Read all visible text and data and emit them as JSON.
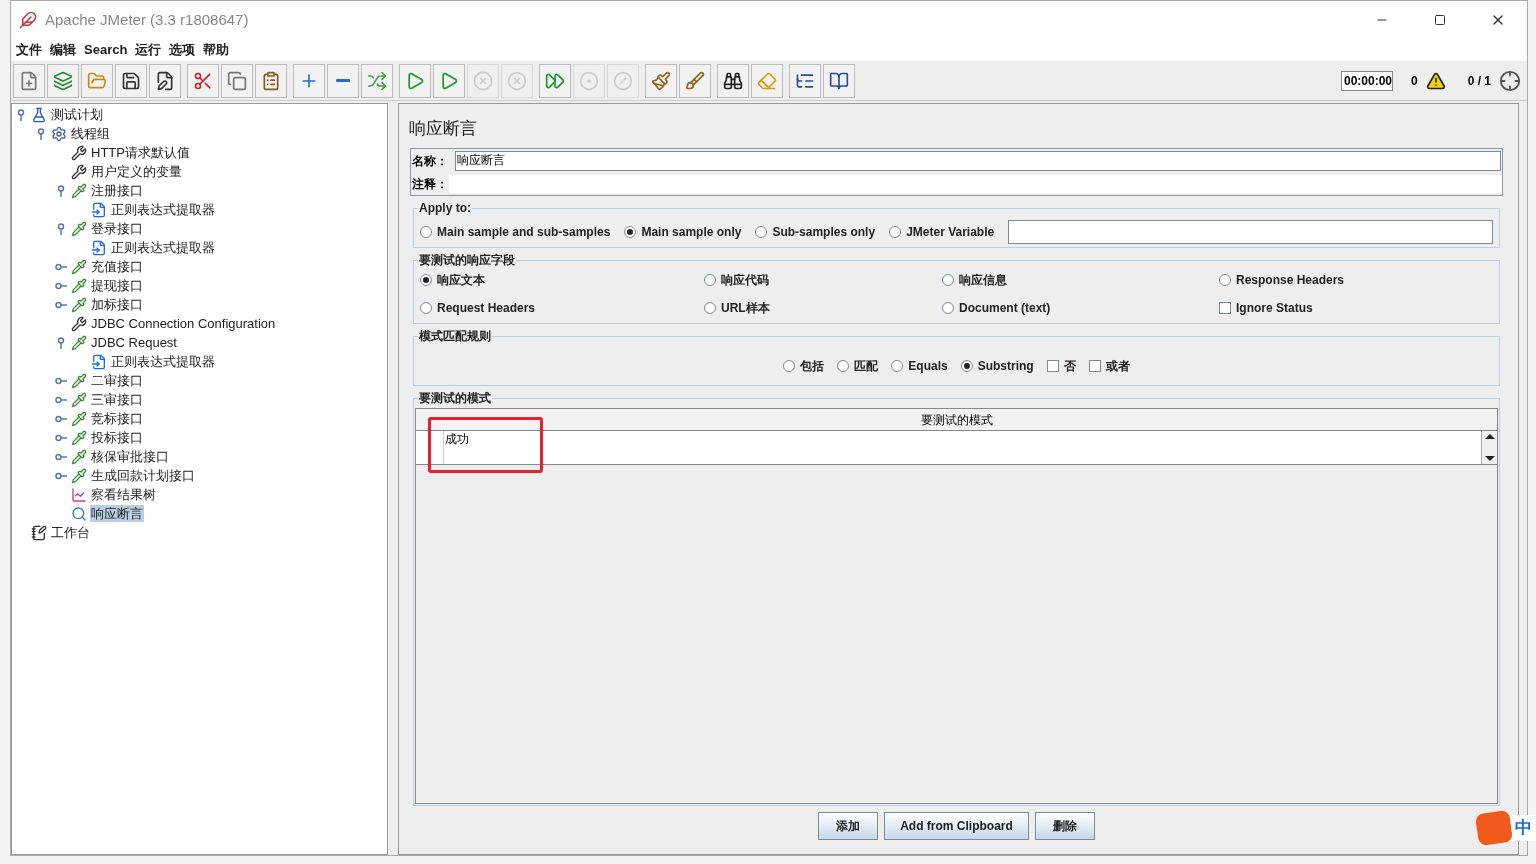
{
  "window": {
    "title": "Apache JMeter (3.3 r1808647)"
  },
  "menu": [
    "文件",
    "编辑",
    "Search",
    "运行",
    "选项",
    "帮助"
  ],
  "toolbar": [
    [
      {
        "kind": "new",
        "disabled": false
      },
      {
        "kind": "templates",
        "disabled": false
      },
      {
        "kind": "open",
        "disabled": false
      },
      {
        "kind": "save",
        "disabled": false
      },
      {
        "kind": "saveas",
        "disabled": false
      }
    ],
    [
      {
        "kind": "cut",
        "disabled": false
      },
      {
        "kind": "copy",
        "disabled": false
      },
      {
        "kind": "paste",
        "disabled": false
      }
    ],
    [
      {
        "kind": "expand",
        "disabled": false
      },
      {
        "kind": "collapse",
        "disabled": false
      },
      {
        "kind": "toggle",
        "disabled": false
      }
    ],
    [
      {
        "kind": "start",
        "disabled": false
      },
      {
        "kind": "startnopause",
        "disabled": false
      },
      {
        "kind": "stop",
        "disabled": true
      },
      {
        "kind": "shutdown",
        "disabled": true
      }
    ],
    [
      {
        "kind": "remotestart",
        "disabled": false
      },
      {
        "kind": "remotestop",
        "disabled": true
      },
      {
        "kind": "remoteexit",
        "disabled": true
      }
    ],
    [
      {
        "kind": "clear",
        "disabled": false
      },
      {
        "kind": "clearall",
        "disabled": false
      }
    ],
    [
      {
        "kind": "search",
        "disabled": false
      },
      {
        "kind": "reset",
        "disabled": false
      }
    ],
    [
      {
        "kind": "functions",
        "disabled": false
      },
      {
        "kind": "help",
        "disabled": false
      }
    ]
  ],
  "status": {
    "timer": "00:00:00",
    "warnings": "0",
    "threads": "0 / 1"
  },
  "tree": [
    {
      "label": "测试计划",
      "kind": "plan",
      "expanded": true,
      "selected": false,
      "children": [
        {
          "label": "线程组",
          "kind": "threadgroup",
          "expanded": true,
          "selected": false,
          "children": [
            {
              "label": "HTTP请求默认值",
              "kind": "config",
              "selected": false
            },
            {
              "label": "用户定义的变量",
              "kind": "config",
              "selected": false
            },
            {
              "label": "注册接口",
              "kind": "sampler",
              "expanded": true,
              "selected": false,
              "children": [
                {
                  "label": "正则表达式提取器",
                  "kind": "extractor",
                  "selected": false
                }
              ]
            },
            {
              "label": "登录接口",
              "kind": "sampler",
              "expanded": true,
              "selected": false,
              "children": [
                {
                  "label": "正则表达式提取器",
                  "kind": "extractor",
                  "selected": false
                }
              ]
            },
            {
              "label": "充值接口",
              "kind": "sampler",
              "expanded": false,
              "selected": false
            },
            {
              "label": "提现接口",
              "kind": "sampler",
              "expanded": false,
              "selected": false
            },
            {
              "label": "加标接口",
              "kind": "sampler",
              "expanded": false,
              "selected": false
            },
            {
              "label": "JDBC Connection Configuration",
              "kind": "config",
              "selected": false
            },
            {
              "label": "JDBC Request",
              "kind": "sampler",
              "expanded": true,
              "selected": false,
              "children": [
                {
                  "label": "正则表达式提取器",
                  "kind": "extractor",
                  "selected": false
                }
              ]
            },
            {
              "label": "二审接口",
              "kind": "sampler",
              "expanded": false,
              "selected": false
            },
            {
              "label": "三审接口",
              "kind": "sampler",
              "expanded": false,
              "selected": false
            },
            {
              "label": "竞标接口",
              "kind": "sampler",
              "expanded": false,
              "selected": false
            },
            {
              "label": "投标接口",
              "kind": "sampler",
              "expanded": false,
              "selected": false
            },
            {
              "label": "核保审批接口",
              "kind": "sampler",
              "expanded": false,
              "selected": false
            },
            {
              "label": "生成回款计划接口",
              "kind": "sampler",
              "expanded": false,
              "selected": false
            },
            {
              "label": "察看结果树",
              "kind": "listener",
              "selected": false
            },
            {
              "label": "响应断言",
              "kind": "assertion",
              "selected": true
            }
          ]
        }
      ]
    },
    {
      "label": "工作台",
      "kind": "workbench",
      "selected": false
    }
  ],
  "panel": {
    "title": "响应断言",
    "name_label": "名称：",
    "name_value": "响应断言",
    "comment_label": "注释：",
    "apply_to": {
      "legend": "Apply to:",
      "options": [
        {
          "label": "Main sample and sub-samples",
          "selected": false
        },
        {
          "label": "Main sample only",
          "selected": true
        },
        {
          "label": "Sub-samples only",
          "selected": false
        },
        {
          "label": "JMeter Variable",
          "selected": false
        }
      ]
    },
    "field": {
      "legend": "要测试的响应字段",
      "options": [
        {
          "label": "响应文本",
          "kind": "radio",
          "selected": true
        },
        {
          "label": "响应代码",
          "kind": "radio",
          "selected": false
        },
        {
          "label": "响应信息",
          "kind": "radio",
          "selected": false
        },
        {
          "label": "Response Headers",
          "kind": "radio",
          "selected": false
        },
        {
          "label": "Request Headers",
          "kind": "radio",
          "selected": false
        },
        {
          "label": "URL样本",
          "kind": "radio",
          "selected": false
        },
        {
          "label": "Document (text)",
          "kind": "radio",
          "selected": false
        },
        {
          "label": "Ignore Status",
          "kind": "checkbox",
          "checked": false
        }
      ]
    },
    "rules": {
      "legend": "模式匹配规则",
      "options": [
        {
          "label": "包括",
          "kind": "radio",
          "selected": false
        },
        {
          "label": "匹配",
          "kind": "radio",
          "selected": false
        },
        {
          "label": "Equals",
          "kind": "radio",
          "selected": false
        },
        {
          "label": "Substring",
          "kind": "radio",
          "selected": true
        },
        {
          "label": "否",
          "kind": "checkbox",
          "checked": false
        },
        {
          "label": "或者",
          "kind": "checkbox",
          "checked": false
        }
      ]
    },
    "patterns": {
      "legend": "要测试的模式",
      "column": "要测试的模式",
      "rows": [
        "成功"
      ]
    },
    "buttons": [
      "添加",
      "Add from Clipboard",
      "删除"
    ]
  },
  "ime": "中"
}
